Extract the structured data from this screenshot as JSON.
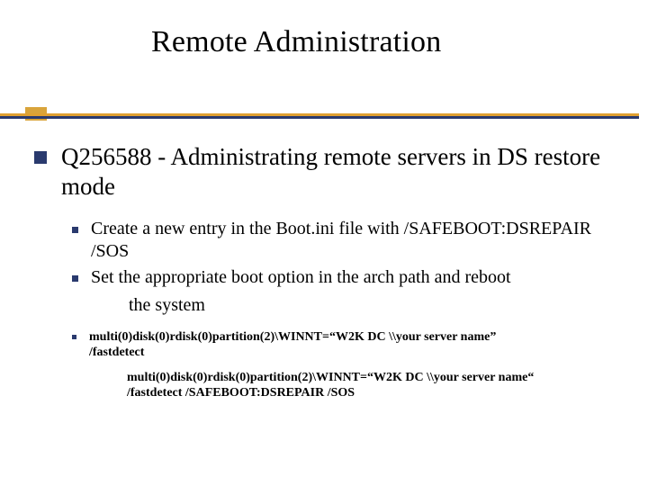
{
  "title": "Remote Administration",
  "topic": "Q256588 - Administrating remote servers in DS restore mode",
  "steps": {
    "s1": "Create a new entry in the Boot.ini file with /SAFEBOOT:DSREPAIR /SOS",
    "s2": "Set the appropriate boot option in the arch path and reboot",
    "s2_cont": "the system"
  },
  "code": {
    "l1a": "multi(0)disk(0)rdisk(0)partition(2)\\WINNT=“W2K DC \\\\your server name”",
    "l1b": "/fastdetect",
    "l2a": "multi(0)disk(0)rdisk(0)partition(2)\\WINNT=“W2K DC \\\\your server name“",
    "l2b": "/fastdetect /SAFEBOOT:DSREPAIR /SOS"
  }
}
